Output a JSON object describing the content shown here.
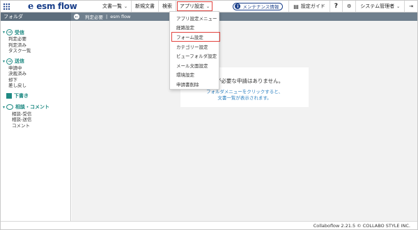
{
  "header": {
    "logo_mark": "e",
    "logo_text": "esm flow",
    "nav": [
      {
        "label": "文書一覧",
        "has_dropdown": true
      },
      {
        "label": "新規文書",
        "has_dropdown": false
      },
      {
        "label": "検索",
        "has_dropdown": false
      },
      {
        "label": "アプリ設定",
        "has_dropdown": true
      }
    ],
    "maintenance_label": "メンテナンス情報",
    "settings_guide_label": "設定ガイド",
    "help_label": "?",
    "gear_icon": "gear-icon",
    "admin_label": "システム管理者",
    "logout_icon": "logout-icon"
  },
  "subbar": {
    "folder_label": "フォルダ",
    "crumb_1": "判定必要",
    "crumb_sep": "|",
    "crumb_2": "esm flow"
  },
  "sidebar": {
    "receive": {
      "label": "受信",
      "items": [
        "判定必要",
        "判定済み",
        "タスク一覧"
      ]
    },
    "send": {
      "label": "送信",
      "items": [
        "申請中",
        "決裁済み",
        "却下",
        "差し戻し"
      ]
    },
    "draft": {
      "label": "下書き"
    },
    "consult": {
      "label": "相談・コメント",
      "items": [
        "相談-受信",
        "相談-送信",
        "コメント"
      ]
    }
  },
  "main": {
    "empty_title": "確認が必要な申請はありません。",
    "empty_sub_1": "フォルダメニューをクリックすると、",
    "empty_sub_2": "文書一覧が表示されます。"
  },
  "dropdown": {
    "items": [
      "アプリ設定メニュー",
      "経路設定",
      "フォーム設定",
      "カテゴリー設定",
      "ビューフォルダ設定",
      "メール文面設定",
      "環境設定",
      "申請書削除"
    ],
    "highlighted_index": 2
  },
  "footer": {
    "text": "Collaboflow 2.21.5 © COLLABO STYLE INC."
  },
  "colors": {
    "brand": "#1a3f8a",
    "accent": "#1f8a83",
    "highlight": "#e2403c",
    "subbar": "#6f7f8d"
  }
}
